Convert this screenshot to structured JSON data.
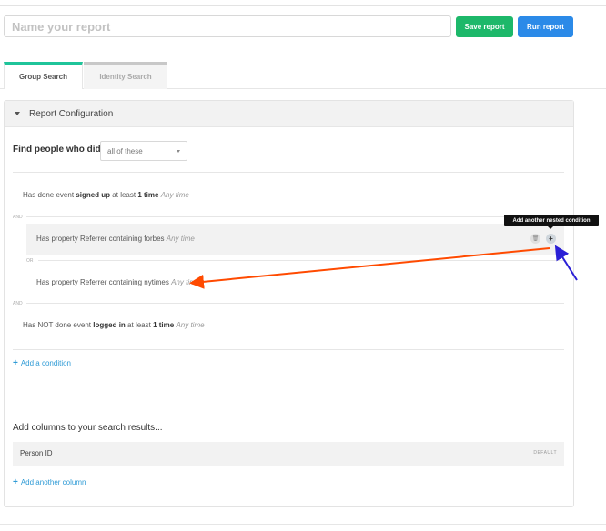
{
  "header": {
    "report_name_placeholder": "Name your report",
    "save_label": "Save report",
    "run_label": "Run report"
  },
  "tabs": [
    {
      "label": "Group Search",
      "active": true
    },
    {
      "label": "Identity Search",
      "active": false
    }
  ],
  "panel": {
    "title": "Report Configuration",
    "find_label": "Find people who did",
    "find_select_value": "all of these"
  },
  "conditions": {
    "c1": {
      "prefix": "Has done event",
      "event": "signed up",
      "mid": "at least",
      "count": "1 time",
      "time": "Any time"
    },
    "and1": "AND",
    "n1": {
      "text": "Has property Referrer containing forbes",
      "time": "Any time"
    },
    "or1": "OR",
    "n2": {
      "text": "Has property Referrer containing nytimes",
      "time": "Any time"
    },
    "and2": "AND",
    "c2": {
      "prefix": "Has NOT done event",
      "event": "logged in",
      "mid": "at least",
      "count": "1 time",
      "time": "Any time"
    }
  },
  "tooltip": "Add another nested condition",
  "add_condition_label": "Add a condition",
  "columns": {
    "title": "Add columns to your search results...",
    "rows": [
      {
        "label": "Person ID",
        "badge": "DEFAULT"
      }
    ],
    "add_label": "Add another column"
  },
  "icons": {
    "trash": "trash-icon",
    "plus": "plus-icon",
    "caret": "caret-down-icon"
  },
  "colors": {
    "save": "#1db86a",
    "run": "#2b8ae8",
    "tab_active": "#1fc49a",
    "link": "#2f9bd6",
    "annotation_arrow": "#ff4a00",
    "pointer_arrow": "#2a1fd6"
  }
}
